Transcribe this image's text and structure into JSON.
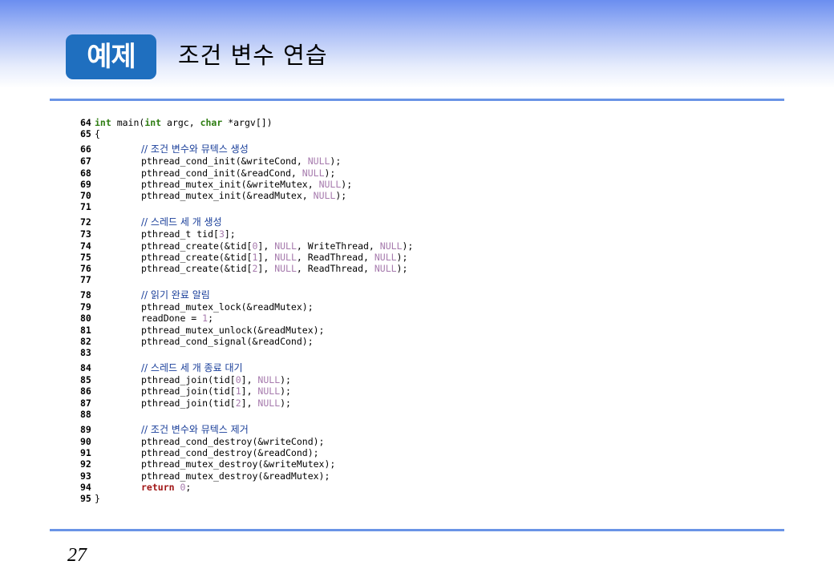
{
  "header": {
    "badge": "예제",
    "title": "조건 변수 연습"
  },
  "code": {
    "lines": [
      {
        "n": "64",
        "t": "int main(int argc, char *argv[])"
      },
      {
        "n": "65",
        "t": "{"
      },
      {
        "n": "66",
        "t": "// 조건 변수와 뮤텍스 생성"
      },
      {
        "n": "67",
        "t": "pthread_cond_init(&writeCond, NULL);"
      },
      {
        "n": "68",
        "t": "pthread_cond_init(&readCond, NULL);"
      },
      {
        "n": "69",
        "t": "pthread_mutex_init(&writeMutex, NULL);"
      },
      {
        "n": "70",
        "t": "pthread_mutex_init(&readMutex, NULL);"
      },
      {
        "n": "71",
        "t": ""
      },
      {
        "n": "72",
        "t": "// 스레드 세 개 생성"
      },
      {
        "n": "73",
        "t": "pthread_t tid[3];"
      },
      {
        "n": "74",
        "t": "pthread_create(&tid[0], NULL, WriteThread, NULL);"
      },
      {
        "n": "75",
        "t": "pthread_create(&tid[1], NULL, ReadThread, NULL);"
      },
      {
        "n": "76",
        "t": "pthread_create(&tid[2], NULL, ReadThread, NULL);"
      },
      {
        "n": "77",
        "t": ""
      },
      {
        "n": "78",
        "t": "// 읽기 완료 알림"
      },
      {
        "n": "79",
        "t": "pthread_mutex_lock(&readMutex);"
      },
      {
        "n": "80",
        "t": "readDone = 1;"
      },
      {
        "n": "81",
        "t": "pthread_mutex_unlock(&readMutex);"
      },
      {
        "n": "82",
        "t": "pthread_cond_signal(&readCond);"
      },
      {
        "n": "83",
        "t": ""
      },
      {
        "n": "84",
        "t": "// 스레드 세 개 종료 대기"
      },
      {
        "n": "85",
        "t": "pthread_join(tid[0], NULL);"
      },
      {
        "n": "86",
        "t": "pthread_join(tid[1], NULL);"
      },
      {
        "n": "87",
        "t": "pthread_join(tid[2], NULL);"
      },
      {
        "n": "88",
        "t": ""
      },
      {
        "n": "89",
        "t": "// 조건 변수와 뮤텍스 제거"
      },
      {
        "n": "90",
        "t": "pthread_cond_destroy(&writeCond);"
      },
      {
        "n": "91",
        "t": "pthread_cond_destroy(&readCond);"
      },
      {
        "n": "92",
        "t": "pthread_mutex_destroy(&writeMutex);"
      },
      {
        "n": "93",
        "t": "pthread_mutex_destroy(&readMutex);"
      },
      {
        "n": "94",
        "t": "return 0;"
      },
      {
        "n": "95",
        "t": "}"
      }
    ]
  },
  "footer": {
    "page_number": "27"
  },
  "colors": {
    "badge": "#1f6fbf",
    "rule": "#6a94e6",
    "keyword": "#2e7d12",
    "return_keyword": "#a01515",
    "null_literal": "#a67aad",
    "comment": "#1a3f9a"
  }
}
